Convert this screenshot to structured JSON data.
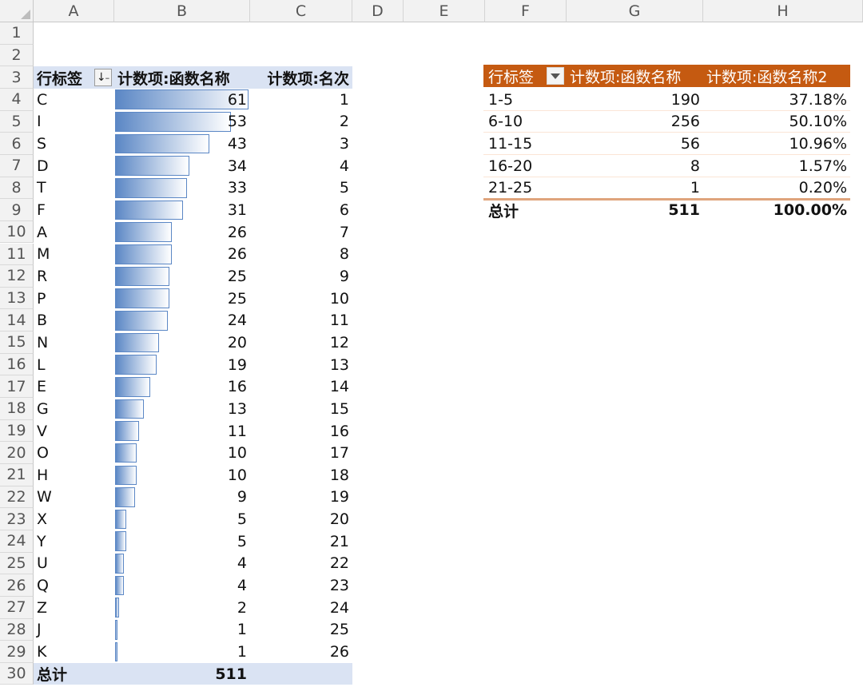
{
  "columns": [
    "A",
    "B",
    "C",
    "D",
    "E",
    "F",
    "G",
    "H"
  ],
  "rows": [
    "1",
    "2",
    "3",
    "4",
    "5",
    "6",
    "7",
    "8",
    "9",
    "10",
    "11",
    "12",
    "13",
    "14",
    "15",
    "16",
    "17",
    "18",
    "19",
    "20",
    "21",
    "22",
    "23",
    "24",
    "25",
    "26",
    "27",
    "28",
    "29",
    "30"
  ],
  "pivot1": {
    "header": {
      "row_label": "行标签",
      "col_b": "计数项:函数名称",
      "col_c": "计数项:名次"
    },
    "sort_icon": "sort-descending-icon",
    "items": [
      {
        "label": "C",
        "count": 61,
        "rank": 1
      },
      {
        "label": "I",
        "count": 53,
        "rank": 2
      },
      {
        "label": "S",
        "count": 43,
        "rank": 3
      },
      {
        "label": "D",
        "count": 34,
        "rank": 4
      },
      {
        "label": "T",
        "count": 33,
        "rank": 5
      },
      {
        "label": "F",
        "count": 31,
        "rank": 6
      },
      {
        "label": "A",
        "count": 26,
        "rank": 7
      },
      {
        "label": "M",
        "count": 26,
        "rank": 8
      },
      {
        "label": "R",
        "count": 25,
        "rank": 9
      },
      {
        "label": "P",
        "count": 25,
        "rank": 10
      },
      {
        "label": "B",
        "count": 24,
        "rank": 11
      },
      {
        "label": "N",
        "count": 20,
        "rank": 12
      },
      {
        "label": "L",
        "count": 19,
        "rank": 13
      },
      {
        "label": "E",
        "count": 16,
        "rank": 14
      },
      {
        "label": "G",
        "count": 13,
        "rank": 15
      },
      {
        "label": "V",
        "count": 11,
        "rank": 16
      },
      {
        "label": "O",
        "count": 10,
        "rank": 17
      },
      {
        "label": "H",
        "count": 10,
        "rank": 18
      },
      {
        "label": "W",
        "count": 9,
        "rank": 19
      },
      {
        "label": "X",
        "count": 5,
        "rank": 20
      },
      {
        "label": "Y",
        "count": 5,
        "rank": 21
      },
      {
        "label": "U",
        "count": 4,
        "rank": 22
      },
      {
        "label": "Q",
        "count": 4,
        "rank": 23
      },
      {
        "label": "Z",
        "count": 2,
        "rank": 24
      },
      {
        "label": "J",
        "count": 1,
        "rank": 25
      },
      {
        "label": "K",
        "count": 1,
        "rank": 26
      }
    ],
    "total": {
      "label": "总计",
      "count": "511"
    },
    "databar_color": "#5b87c5",
    "header_color": "#dae3f3"
  },
  "pivot2": {
    "header": {
      "row_label": "行标签",
      "col_g": "计数项:函数名称",
      "col_h": "计数项:函数名称2"
    },
    "items": [
      {
        "label": "1-5",
        "count": "190",
        "pct": "37.18%"
      },
      {
        "label": "6-10",
        "count": "256",
        "pct": "50.10%"
      },
      {
        "label": "11-15",
        "count": "56",
        "pct": "10.96%"
      },
      {
        "label": "16-20",
        "count": "8",
        "pct": "1.57%"
      },
      {
        "label": "21-25",
        "count": "1",
        "pct": "0.20%"
      }
    ],
    "total": {
      "label": "总计",
      "count": "511",
      "pct": "100.00%"
    },
    "header_color": "#c55a11",
    "filter_icon": "dropdown-arrow-icon"
  }
}
